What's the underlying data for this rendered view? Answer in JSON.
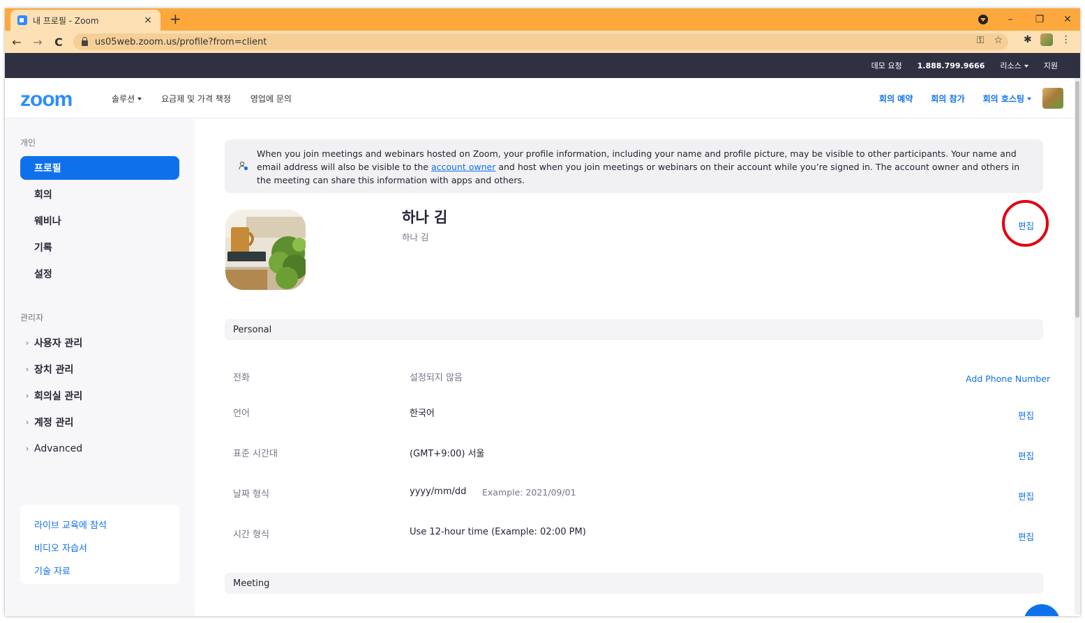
{
  "browser": {
    "tab_title": "내 프로필 - Zoom",
    "tab_close": "×",
    "new_tab": "+",
    "url": "us05web.zoom.us/profile?from=client",
    "minimize": "–",
    "restore": "❐",
    "close": "✕",
    "back": "←",
    "forward": "→",
    "reload": "C",
    "key_icon": "⚿",
    "star_icon": "☆",
    "ext_icon": "✱",
    "menu_icon": "⋮"
  },
  "topbar": {
    "demo": "데모 요청",
    "phone": "1.888.799.9666",
    "resources": "리소스",
    "support": "지원"
  },
  "header": {
    "logo": "zoom",
    "nav": [
      "솔루션",
      "요금제 및 가격 책정",
      "영업에 문의"
    ],
    "schedule": "회의 예약",
    "join": "회의 참가",
    "host": "회의 호스팅"
  },
  "sidebar": {
    "personal_title": "개인",
    "personal_items": [
      "프로필",
      "회의",
      "웨비나",
      "기록",
      "설정"
    ],
    "admin_title": "관리자",
    "admin_items": [
      "사용자 관리",
      "장치 관리",
      "회의실 관리",
      "계정 관리",
      "Advanced"
    ],
    "help_links": [
      "라이브 교육에 참석",
      "비디오 자습서",
      "기술 자료"
    ]
  },
  "notice": {
    "before_link": "When you join meetings and webinars hosted on Zoom, your profile information, including your name and profile picture, may be visible to other participants. Your name and email address will also be visible to the ",
    "link": "account owner",
    "after_link": " and host when you join meetings or webinars on their account while you’re signed in. The account owner and others in the meeting can share this information with apps and others."
  },
  "profile": {
    "name": "하나 김",
    "display_name": "하나 김",
    "edit": "편집"
  },
  "personal": {
    "title": "Personal",
    "phone_label": "전화",
    "phone_value": "설정되지 않음",
    "phone_action": "Add Phone Number",
    "language_label": "언어",
    "language_value": "한국어",
    "timezone_label": "표준 시간대",
    "timezone_value": "(GMT+9:00) 서울",
    "date_label": "날짜 형식",
    "date_value": "yyyy/mm/dd",
    "date_example": "Example: 2021/09/01",
    "time_label": "시간 형식",
    "time_value": "Use 12-hour time (Example: 02:00 PM)",
    "edit": "편집"
  },
  "meeting": {
    "title": "Meeting"
  },
  "colors": {
    "chrome_frame": "#fca83c",
    "zoom_blue": "#0e71eb",
    "topbar_bg": "#2f3142",
    "highlight_circle": "#e3000f"
  }
}
